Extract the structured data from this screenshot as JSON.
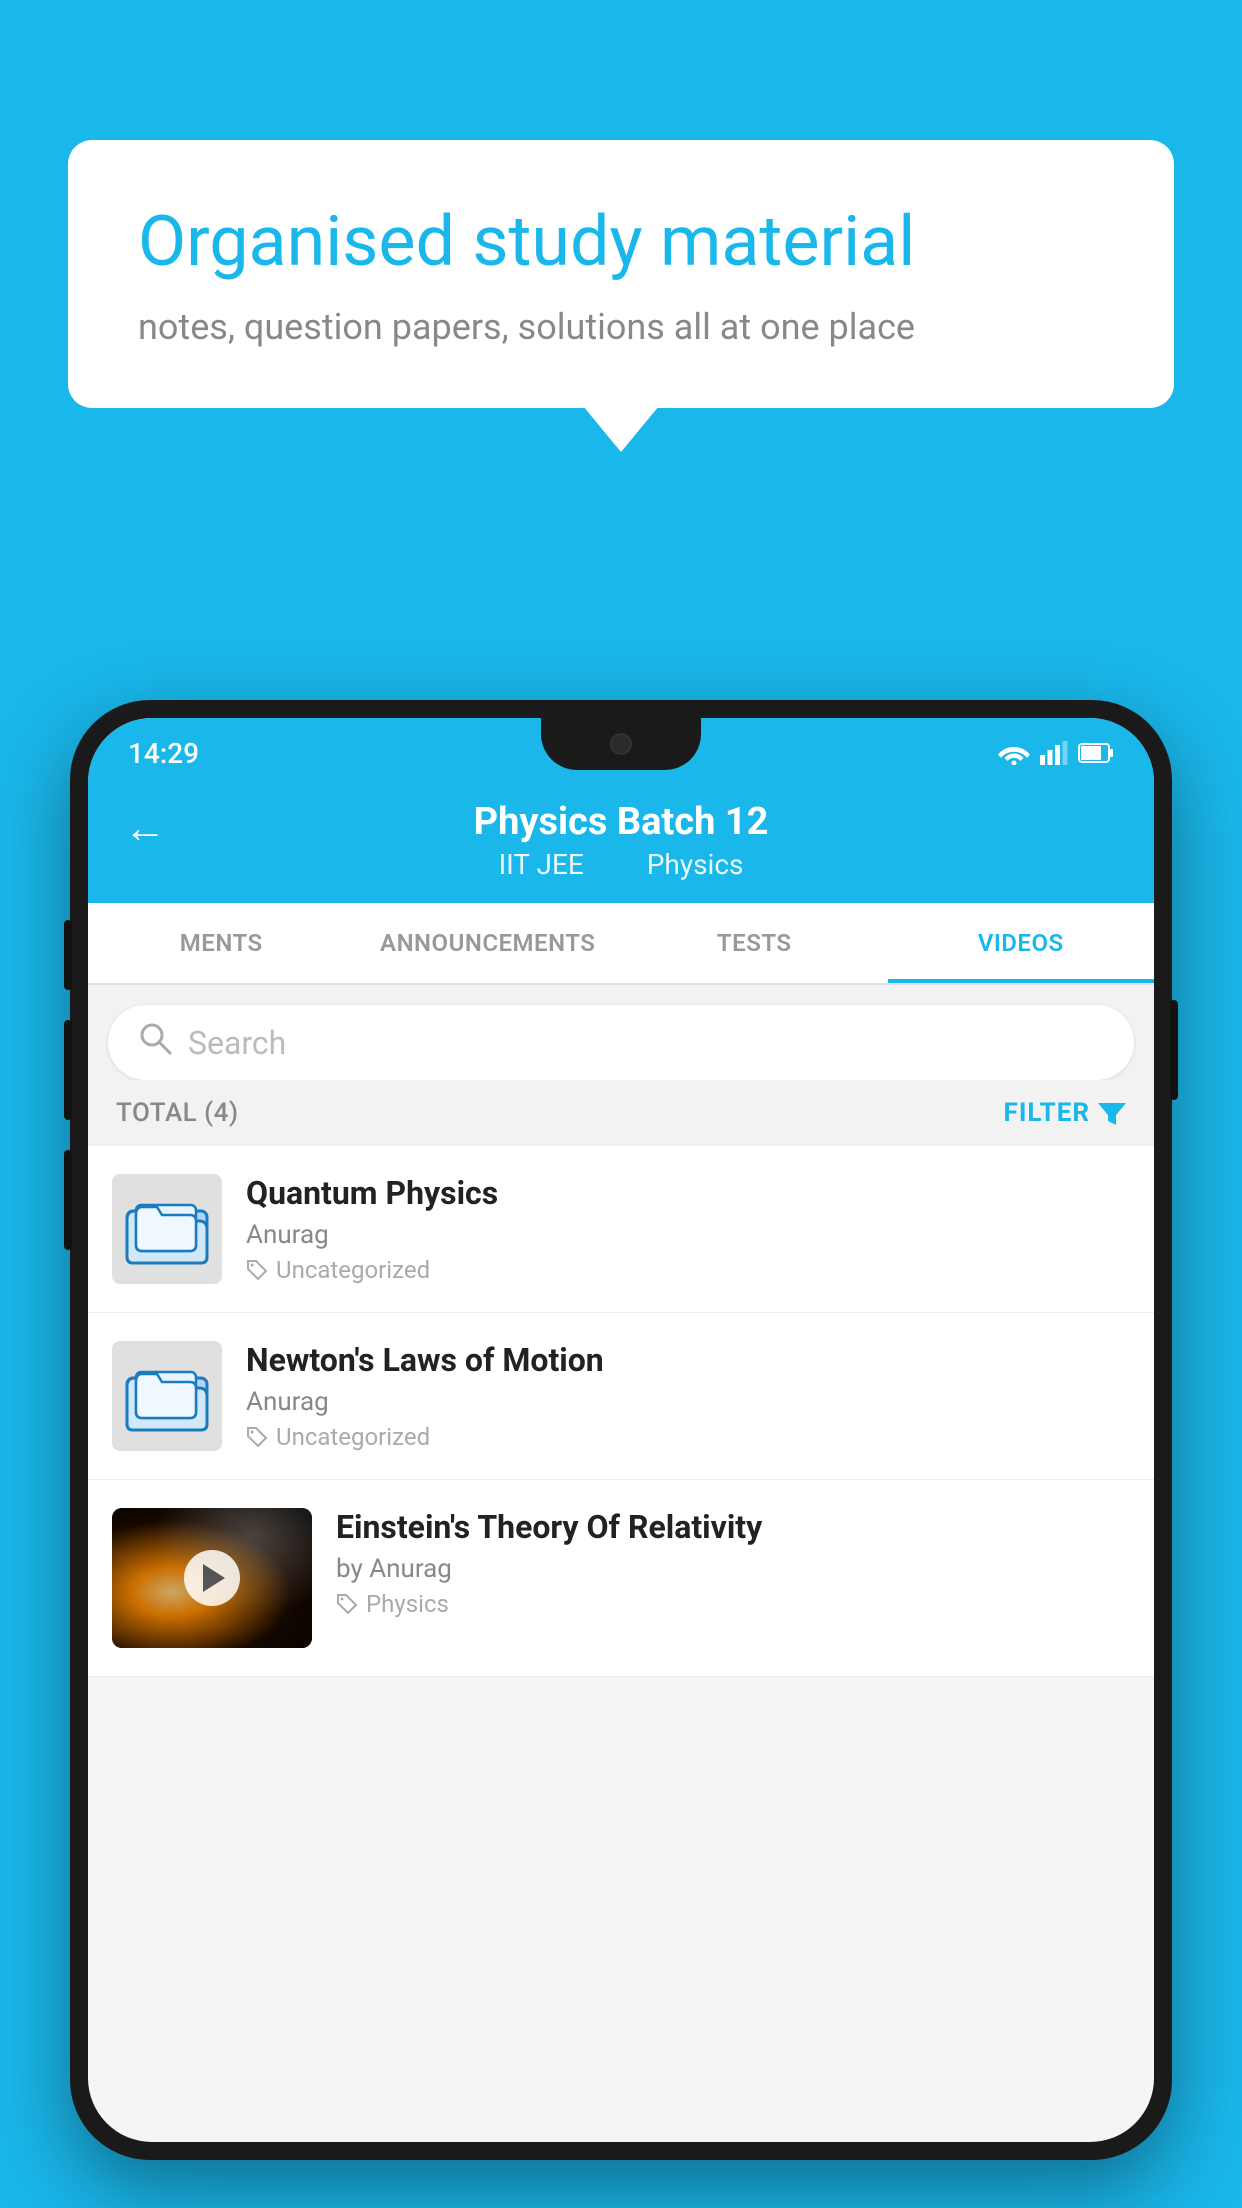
{
  "page": {
    "background_color": "#1ab7ea"
  },
  "speech_bubble": {
    "title": "Organised study material",
    "subtitle": "notes, question papers, solutions all at one place"
  },
  "phone": {
    "status_bar": {
      "time": "14:29"
    },
    "app_bar": {
      "title": "Physics Batch 12",
      "subtitle_part1": "IIT JEE",
      "subtitle_part2": "Physics",
      "back_label": "←"
    },
    "tabs": [
      {
        "label": "MENTS",
        "active": false
      },
      {
        "label": "ANNOUNCEMENTS",
        "active": false
      },
      {
        "label": "TESTS",
        "active": false
      },
      {
        "label": "VIDEOS",
        "active": true
      }
    ],
    "search": {
      "placeholder": "Search"
    },
    "filter_bar": {
      "total_label": "TOTAL (4)",
      "filter_label": "FILTER"
    },
    "videos": [
      {
        "id": "quantum",
        "title": "Quantum Physics",
        "author": "Anurag",
        "tag": "Uncategorized",
        "has_thumbnail": false
      },
      {
        "id": "newton",
        "title": "Newton's Laws of Motion",
        "author": "Anurag",
        "tag": "Uncategorized",
        "has_thumbnail": false
      },
      {
        "id": "einstein",
        "title": "Einstein's Theory Of Relativity",
        "author": "by Anurag",
        "tag": "Physics",
        "has_thumbnail": true
      }
    ]
  }
}
